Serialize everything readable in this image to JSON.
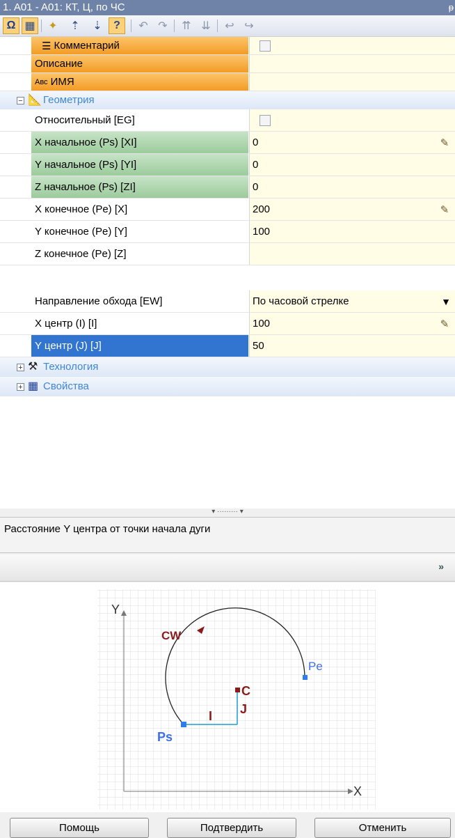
{
  "window": {
    "title": "1. A01 - A01: КТ, Ц, по ЧС",
    "pin_icon": "pin-icon"
  },
  "toolbar": {
    "buttons": [
      {
        "icon": "omega-icon",
        "glyph": "Ω",
        "active": true
      },
      {
        "icon": "table-view-icon",
        "glyph": "▦",
        "active": true
      },
      {
        "icon": "new-item-icon",
        "glyph": "✦",
        "active": false
      },
      {
        "icon": "move-up-icon",
        "glyph": "⇡",
        "active": false
      },
      {
        "icon": "move-down-icon",
        "glyph": "⇣",
        "active": false
      },
      {
        "icon": "help-context-icon",
        "glyph": "?",
        "active": true
      },
      {
        "icon": "rotate-icon",
        "glyph": "↶",
        "dim": true
      },
      {
        "icon": "rotate-right-icon",
        "glyph": "↷",
        "dim": true
      },
      {
        "icon": "sort-up-icon",
        "glyph": "⇈",
        "dim": true
      },
      {
        "icon": "sort-down-icon",
        "glyph": "⇊",
        "dim": true
      },
      {
        "icon": "undo-icon",
        "glyph": "↩",
        "dim": true
      },
      {
        "icon": "redo-icon",
        "glyph": "↪",
        "dim": true
      }
    ]
  },
  "props": {
    "comment": {
      "label": "Комментарий",
      "value": ""
    },
    "description": {
      "label": "Описание",
      "value": ""
    },
    "name": {
      "label": "ИМЯ",
      "prefix": "Авс",
      "value": ""
    },
    "geometry": {
      "label": "Геометрия"
    },
    "relative": {
      "label": "Относительный [EG]"
    },
    "x_start": {
      "label": "X начальное (Ps) [XI]",
      "value": "0"
    },
    "y_start": {
      "label": "Y начальное (Ps) [YI]",
      "value": "0"
    },
    "z_start": {
      "label": "Z начальное (Ps) [ZI]",
      "value": "0"
    },
    "x_end": {
      "label": "X конечное (Pe) [X]",
      "value": "200"
    },
    "y_end": {
      "label": "Y конечное (Pe) [Y]",
      "value": "100"
    },
    "z_end": {
      "label": "Z конечное (Pe) [Z]",
      "value": ""
    },
    "direction": {
      "label": "Направление обхода [EW]",
      "value": "По часовой стрелке"
    },
    "x_center": {
      "label": "X центр (I) [I]",
      "value": "100"
    },
    "y_center": {
      "label": "Y центр (J) [J]",
      "value": "50"
    },
    "technology": {
      "label": "Технология"
    },
    "properties": {
      "label": "Свойства"
    }
  },
  "description_text": "Расстояние Y центра от точки начала дуги",
  "diagram": {
    "axis_x": "X",
    "axis_y": "Y",
    "cw": "CW",
    "pe": "Pe",
    "ps": "Ps",
    "c": "C",
    "i": "I",
    "j": "J",
    "colors": {
      "arc": "#222222",
      "point": "#2f7de8",
      "label_blue": "#3d6fe8",
      "label_red": "#8b1a1a",
      "vector": "#1f9bd6"
    }
  },
  "buttons": {
    "help": "Помощь",
    "confirm": "Подтвердить",
    "cancel": "Отменить"
  }
}
